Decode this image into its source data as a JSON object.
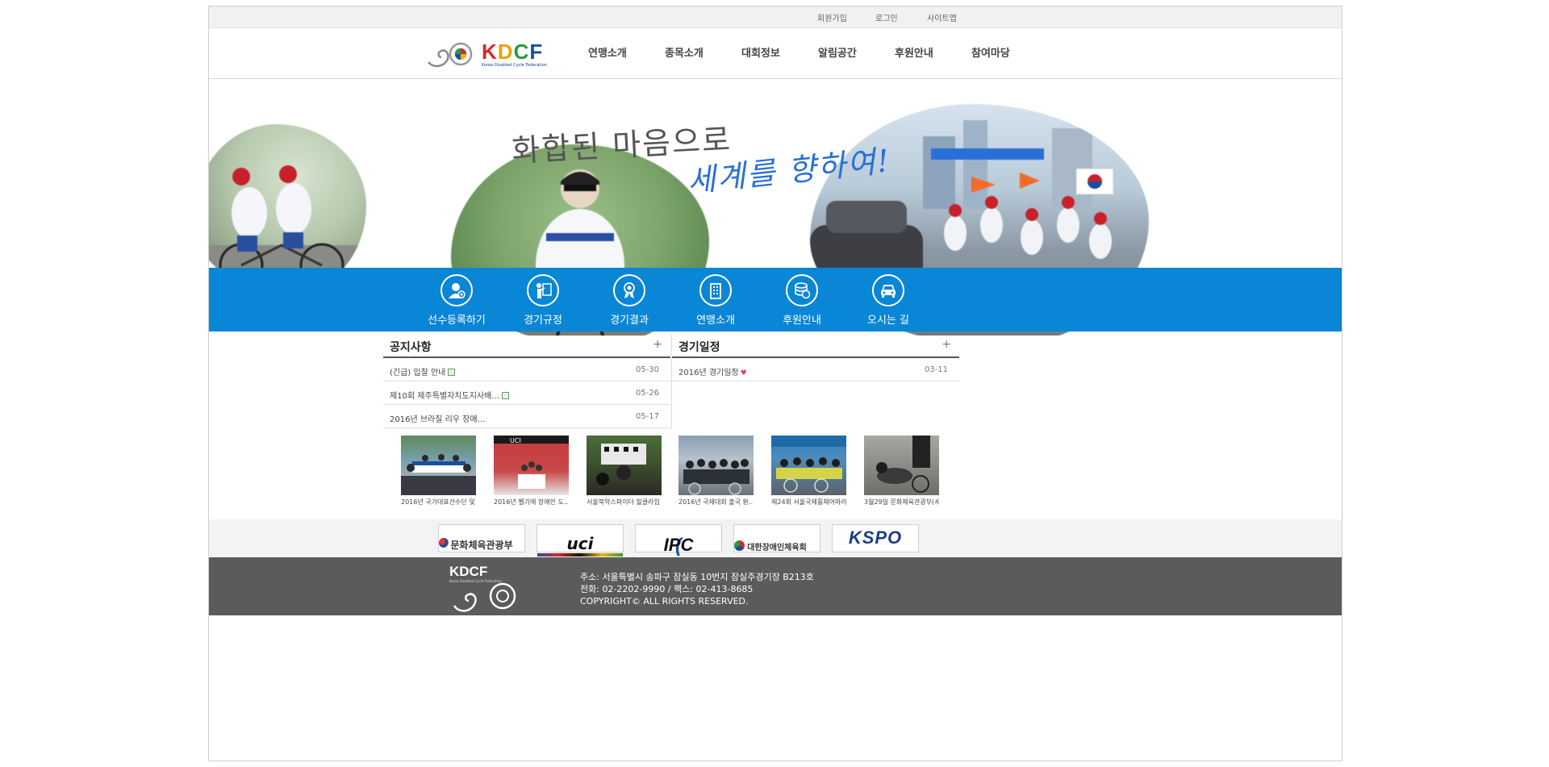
{
  "util_links": [
    "회원가입",
    "로그인",
    "사이트맵"
  ],
  "logo": {
    "text": "KDCF",
    "subtitle": "Korea Disabled Cycle Federation"
  },
  "nav": [
    "연맹소개",
    "종목소개",
    "대회정보",
    "알림공간",
    "후원안내",
    "참여마당"
  ],
  "hero": {
    "line1": "화합된 마음으로",
    "line2": "세계를 향하여!"
  },
  "quick_menu": [
    {
      "label": "선수등록하기",
      "icon": "user-add-icon"
    },
    {
      "label": "경기규정",
      "icon": "rules-icon"
    },
    {
      "label": "경기결과",
      "icon": "medal-icon"
    },
    {
      "label": "연맹소개",
      "icon": "building-icon"
    },
    {
      "label": "후원안내",
      "icon": "donation-icon"
    },
    {
      "label": "오시는 길",
      "icon": "car-icon"
    }
  ],
  "notice": {
    "title": "공지사항",
    "more": "+",
    "items": [
      {
        "title": "(긴급) 입찰 안내",
        "date": "05-30"
      },
      {
        "title": "제10회 제주특별자치도지사배…",
        "date": "05-26"
      },
      {
        "title": "2016년 브라질 리우 장애…",
        "date": "05-17"
      }
    ]
  },
  "schedule": {
    "title": "경기일정",
    "more": "+",
    "items": [
      {
        "title": "2016년 경기일정",
        "date": "03-11"
      }
    ]
  },
  "gallery": [
    {
      "caption": "2016년 국가대표선수단 및"
    },
    {
      "caption": "2016년 벨기에 장애인 도…"
    },
    {
      "caption": "서울북악스파이더 힐클라임"
    },
    {
      "caption": "2016년 국제대회 출국 환…"
    },
    {
      "caption": "제24회 서울국제휠체어마라"
    },
    {
      "caption": "3월29일 문화체육관광부(세"
    }
  ],
  "sponsors": [
    "문화체육관광부",
    "uci",
    "IPC",
    "대한장애인체육회",
    "KSPO"
  ],
  "footer": {
    "logo": "KDCF",
    "address": "주소: 서울특별시 송파구 잠실동 10번지 잠실주경기장 B213호",
    "phone": "전화: 02-2202-9990 / 팩스: 02-413-8685",
    "copyright": "COPYRIGHT© ALL RIGHTS RESERVED."
  },
  "colors": {
    "brand_blue": "#0a86d6",
    "footer_gray": "#5b5b5b"
  }
}
